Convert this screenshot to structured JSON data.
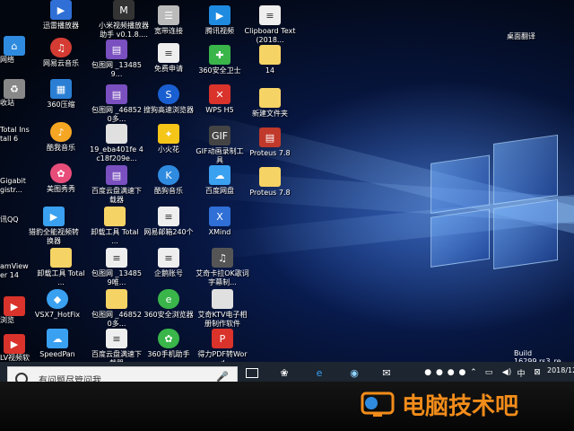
{
  "desktop_icons": [
    {
      "label": "迅雷播放器",
      "color": "#2f6fd6"
    },
    {
      "label": "小米视频播放器助手 v0.1.8....",
      "color": "#333"
    },
    {
      "label": "宽带连接",
      "color": "#8a8a8a"
    },
    {
      "label": "腾讯视频",
      "color": "#1f8be0"
    },
    {
      "label": "Clipboard Text (2018...",
      "color": "#f2f2f2"
    },
    {
      "label": "网易云音乐",
      "color": "#d43c33"
    },
    {
      "label": "包图网 _134859...",
      "color": "#7a4fbf"
    },
    {
      "label": "免费申请",
      "color": "#f2f2f2"
    },
    {
      "label": "360安全卫士",
      "color": "#39b54a"
    },
    {
      "label": "14",
      "color": "#f6d365"
    },
    {
      "label": "360压缩",
      "color": "#2a7fd4"
    },
    {
      "label": "包图网 _468520多...",
      "color": "#7a4fbf"
    },
    {
      "label": "搜狗高速浏览器",
      "color": "#1a5fd1"
    },
    {
      "label": "WPS H5",
      "color": "#d9332b"
    },
    {
      "label": "新建文件夹",
      "color": "#f6d365"
    },
    {
      "label": "酷我音乐",
      "color": "#f5a623"
    },
    {
      "label": "19_eba401fe 4c18f209e...",
      "color": "#e0e0e0"
    },
    {
      "label": "小火花",
      "color": "#f5c518"
    },
    {
      "label": "GIF动画录制工具",
      "color": "#444"
    },
    {
      "label": "Proteus 7.8",
      "color": "#c0392b"
    },
    {
      "label": "美图秀秀",
      "color": "#e84d7a"
    },
    {
      "label": "百度云盘满速下载器",
      "color": "#7a4fbf"
    },
    {
      "label": "酷狗音乐",
      "color": "#2f8be0"
    },
    {
      "label": "百度网盘",
      "color": "#3aa0f0"
    },
    {
      "label": "Proteus 7.8",
      "color": "#f6d365"
    },
    {
      "label": "猎豹全能视频转换器",
      "color": "#3aa0f0"
    },
    {
      "label": "卸载工具 Total ...",
      "color": "#f6d365"
    },
    {
      "label": "网易邮箱240个",
      "color": "#f2f2f2"
    },
    {
      "label": "XMind",
      "color": "#2f6fd6"
    },
    {
      "label": "卸载工具 Total ...",
      "color": "#f6d365"
    },
    {
      "label": "包图网 _134859唯...",
      "color": "#f2f2f2"
    },
    {
      "label": "企鹅账号",
      "color": "#f2f2f2"
    },
    {
      "label": "艾奇卡拉OK歌词字幕制...",
      "color": "#555"
    },
    {
      "label": "VSX7_HotFix",
      "color": "#3aa0f0"
    },
    {
      "label": "包图网 _468520多...",
      "color": "#f6d365"
    },
    {
      "label": "360安全浏览器",
      "color": "#39b54a"
    },
    {
      "label": "艾奇KTV电子相册制作软件",
      "color": "#e0e0e0"
    },
    {
      "label": "SpeedPan",
      "color": "#3aa0f0"
    },
    {
      "label": "百度云盘满速下载器",
      "color": "#f2f2f2"
    },
    {
      "label": "360手机助手",
      "color": "#39b54a"
    },
    {
      "label": "得力PDF转Word",
      "color": "#d9332b"
    }
  ],
  "left_edge_labels": [
    "网络",
    "收站",
    "Total Install 6",
    "Gigabit gistr...",
    "讯QQ",
    "amViewer 14",
    "浏览",
    "LV视频软件"
  ],
  "top_right_label": "桌面翻译",
  "build_text": "Build 16299.rs3_re",
  "search": {
    "placeholder": "有问题尽管问我"
  },
  "tray": {
    "ime": "中",
    "date": "2018/12"
  },
  "watermark": {
    "text": "电脑技术吧"
  }
}
